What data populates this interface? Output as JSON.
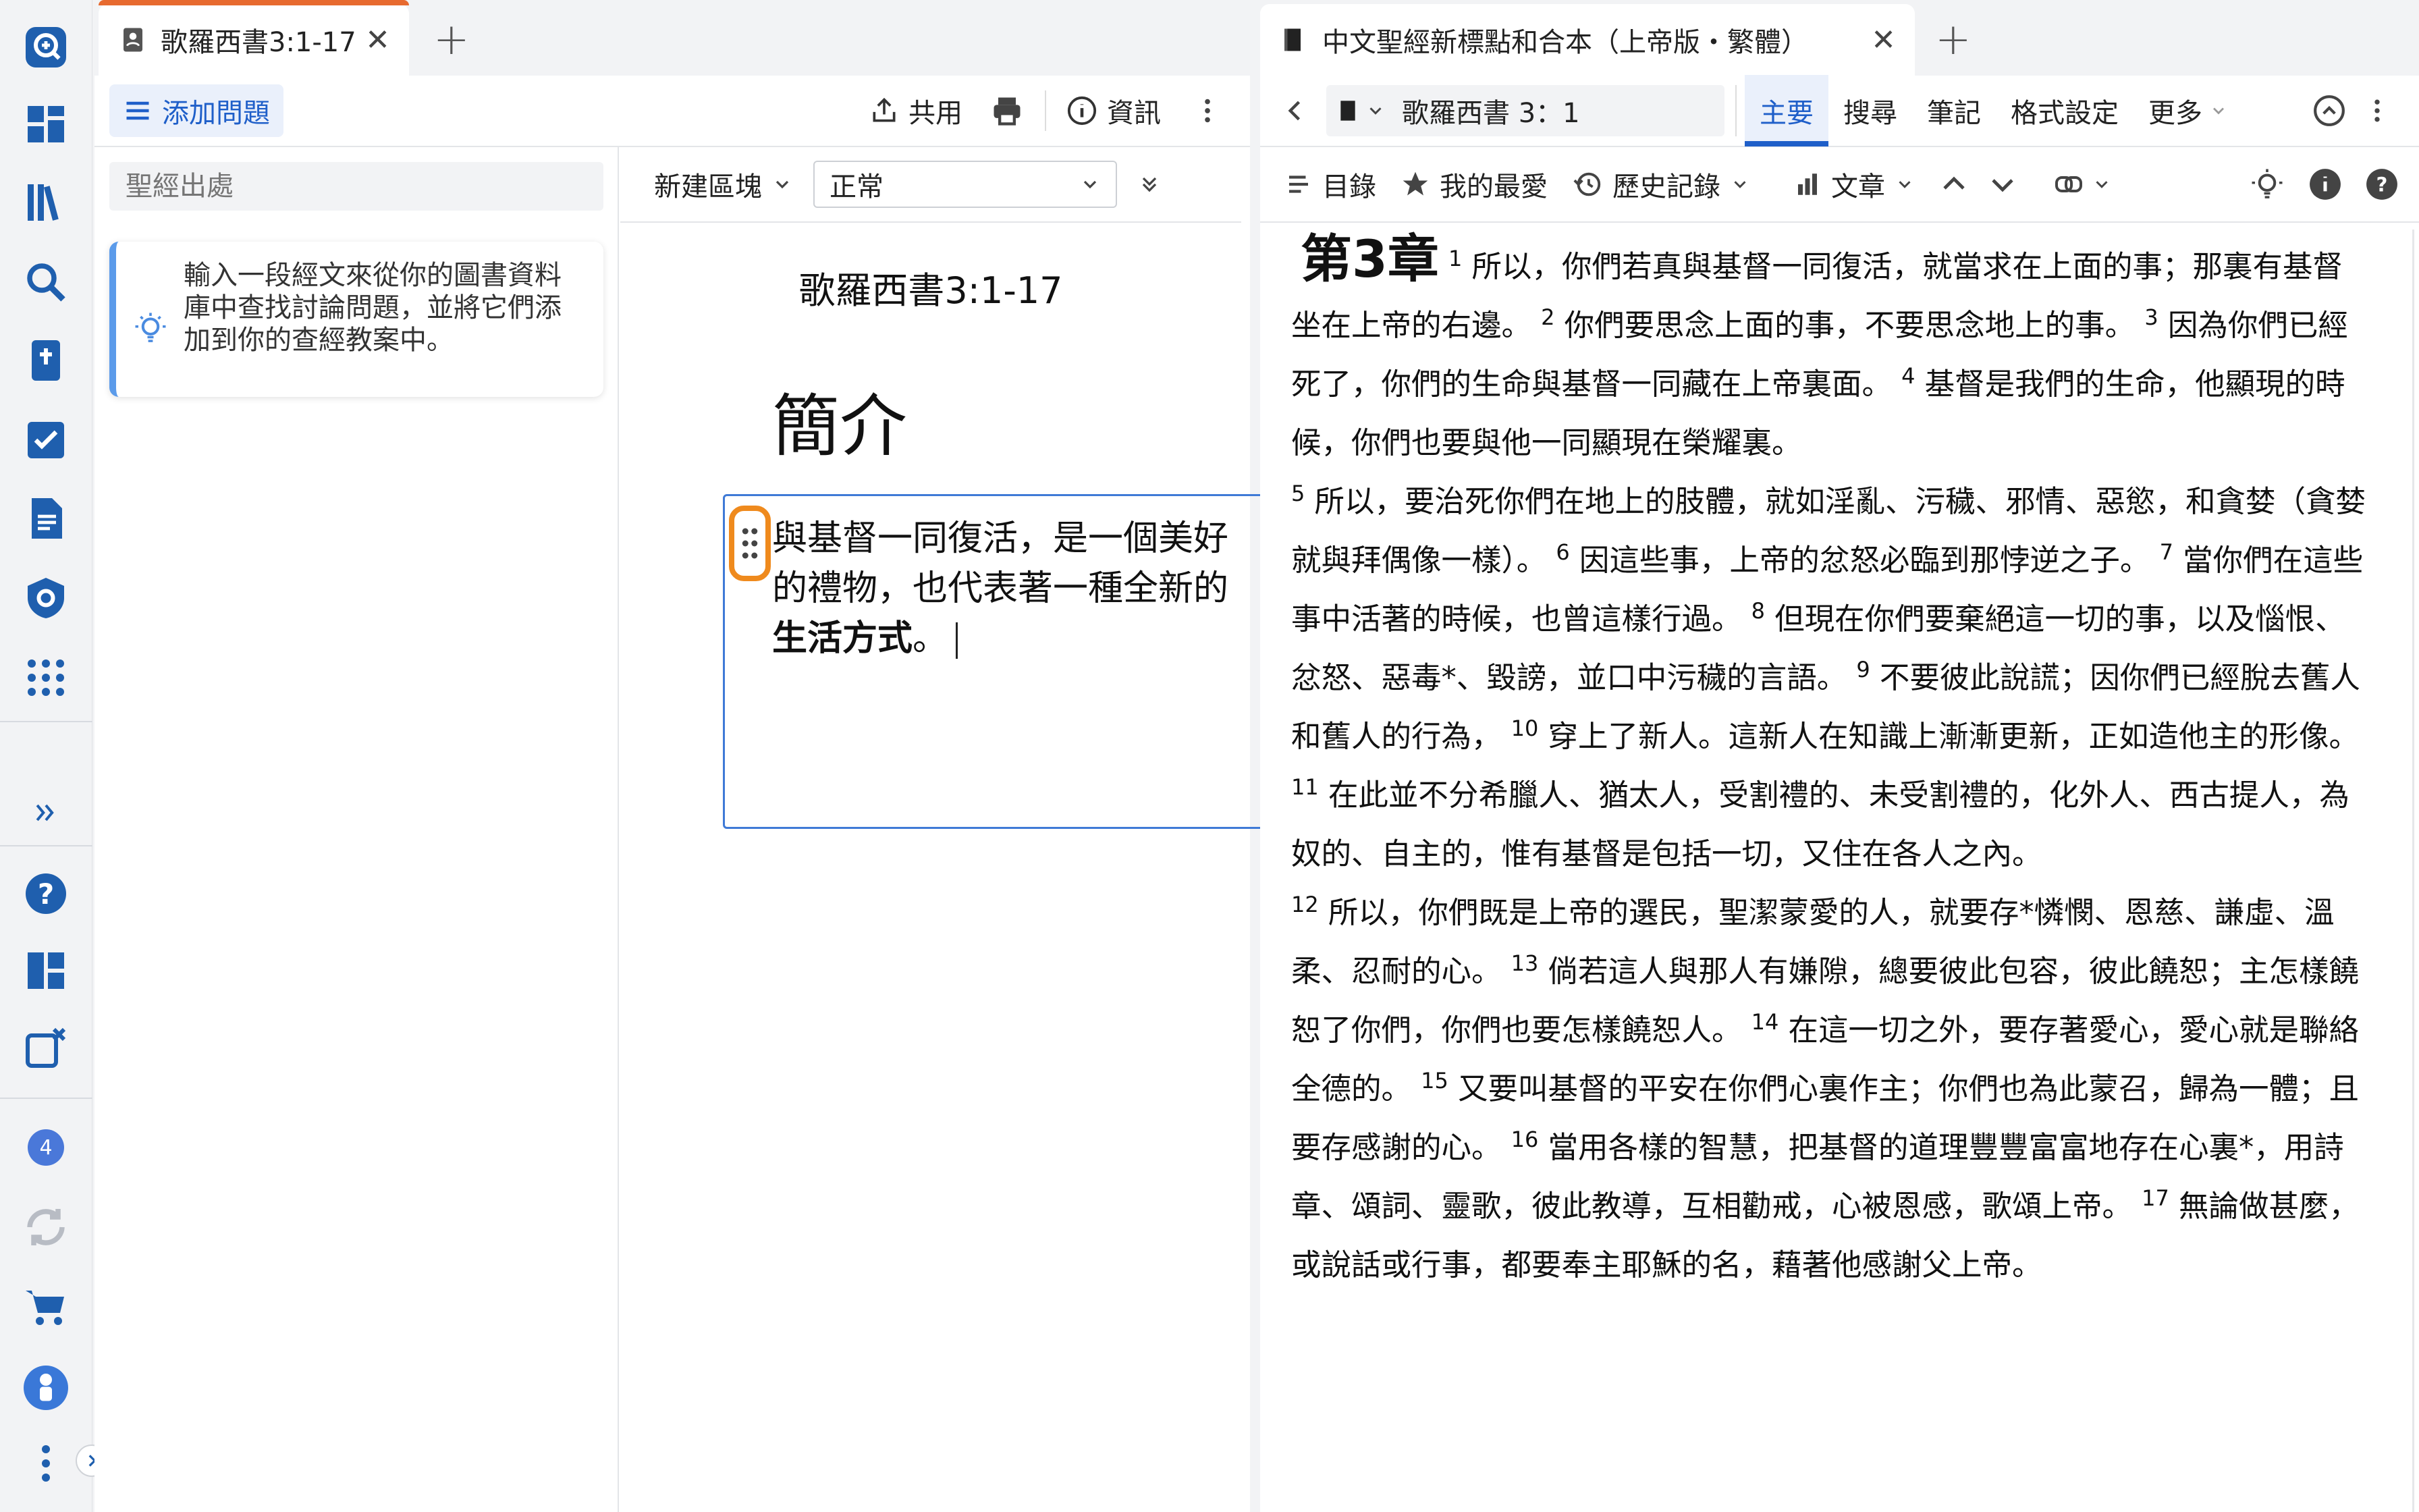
{
  "left_tab": {
    "title": "歌羅西書3:1-17"
  },
  "left_toolbar": {
    "add_question": "添加問題",
    "share": "共用",
    "info": "資訊"
  },
  "reference_input": {
    "placeholder": "聖經出處"
  },
  "hint": {
    "text": "輸入一段經文來從你的圖書資料庫中查找討論問題，並將它們添加到你的查經教案中。"
  },
  "doc_toolbar": {
    "new_block": "新建區塊",
    "style_value": "正常"
  },
  "doc": {
    "title": "歌羅西書3:1-17",
    "heading": "簡介",
    "block_text": "與基督一同復活，是一個美好的禮物，也代表著一種全新的",
    "block_bold": "生活方式",
    "block_end": "。"
  },
  "right_tab": {
    "title": "中文聖經新標點和合本（上帝版・繁體）"
  },
  "right_toolbar": {
    "reference": "歌羅西書 3：1",
    "tabs": [
      "主要",
      "搜尋",
      "筆記",
      "格式設定",
      "更多"
    ],
    "active_tab": "主要"
  },
  "right_subtoolbar": {
    "toc": "目錄",
    "favorites": "我的最愛",
    "history": "歷史記錄",
    "text": "文章"
  },
  "bible": {
    "chapter": "第3章",
    "verses": [
      {
        "n": "1",
        "t": "所以，你們若真與基督一同復活，就當求在上面的事；那裏有基督 坐在上帝的右邊。"
      },
      {
        "n": "2",
        "t": "你們要思念上面的事，不要思念地上的事。"
      },
      {
        "n": "3",
        "t": "因為你們已經死了，你們的生命與基督一同藏在上帝裏面。"
      },
      {
        "n": "4",
        "t": "基督是我們的生命，他顯現的時候，你們也要與他一同顯現在榮耀裏。"
      },
      {
        "n": "5",
        "t": "所以，要治死你們在地上的肢體，就如淫亂、污穢、邪情、惡慾，和貪婪（貪婪就與拜偶像一樣）。"
      },
      {
        "n": "6",
        "t": "因這些事，上帝的忿怒必臨到那悖逆之子。"
      },
      {
        "n": "7",
        "t": "當你們在這些事中活著的時候，也曾這樣行過。"
      },
      {
        "n": "8",
        "t": "但現在你們要棄絕這一切的事，以及惱恨、忿怒、惡毒*、毀謗，並口中污穢的言語。"
      },
      {
        "n": "9",
        "t": "不要彼此說謊；因你們已經脫去舊人和舊人的行為，"
      },
      {
        "n": "10",
        "t": "穿上了新人。這新人在知識上漸漸更新，正如造他主的形像。"
      },
      {
        "n": "11",
        "t": "在此並不分希臘人、猶太人，受割禮的、未受割禮的，化外人、西古提人，為奴的、自主的，惟有基督是包括一切，又住在各人之內。"
      },
      {
        "n": "12",
        "t": "所以，你們既是上帝的選民，聖潔蒙愛的人，就要存*憐憫、恩慈、謙虛、溫柔、忍耐的心。"
      },
      {
        "n": "13",
        "t": "倘若這人與那人有嫌隙，總要彼此包容，彼此饒恕；主怎樣饒恕了你們，你們也要怎樣饒恕人。"
      },
      {
        "n": "14",
        "t": "在這一切之外，要存著愛心，愛心就是聯絡全德的。"
      },
      {
        "n": "15",
        "t": "又要叫基督的平安在你們心裏作主；你們也為此蒙召，歸為一體；且要存感謝的心。"
      },
      {
        "n": "16",
        "t": "當用各樣的智慧，把基督的道理豐豐富富地存在心裏*，用詩章、頌詞、靈歌，彼此教導，互相勸戒，心被恩感，歌頌上帝。"
      },
      {
        "n": "17",
        "t": "無論做甚麼，或說話或行事，都要奉主耶穌的名，藉著他感謝父上帝。"
      }
    ]
  },
  "rail": {
    "notification_count": "4"
  },
  "colors": {
    "accent": "#3f7ad6",
    "orange": "#e76a2f",
    "rail_icon": "#1f5fae"
  }
}
